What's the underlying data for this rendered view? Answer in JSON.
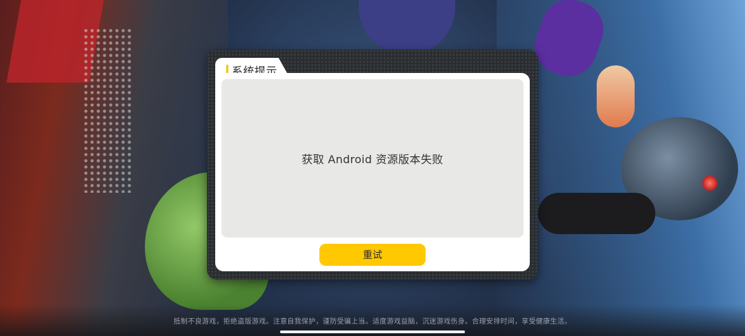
{
  "dialog": {
    "title": "系统提示",
    "message": "获取 Android 资源版本失败",
    "retry_label": "重试"
  },
  "footer": {
    "health_notice": "抵制不良游戏，拒绝盗版游戏。注意自我保护，谨防受骗上当。适度游戏益脑，沉迷游戏伤身。合理安排时间，享受健康生活。"
  },
  "colors": {
    "accent": "#f5c400",
    "button": "#ffc800",
    "frame": "#2a2d30",
    "panel": "#e8e9e7"
  }
}
